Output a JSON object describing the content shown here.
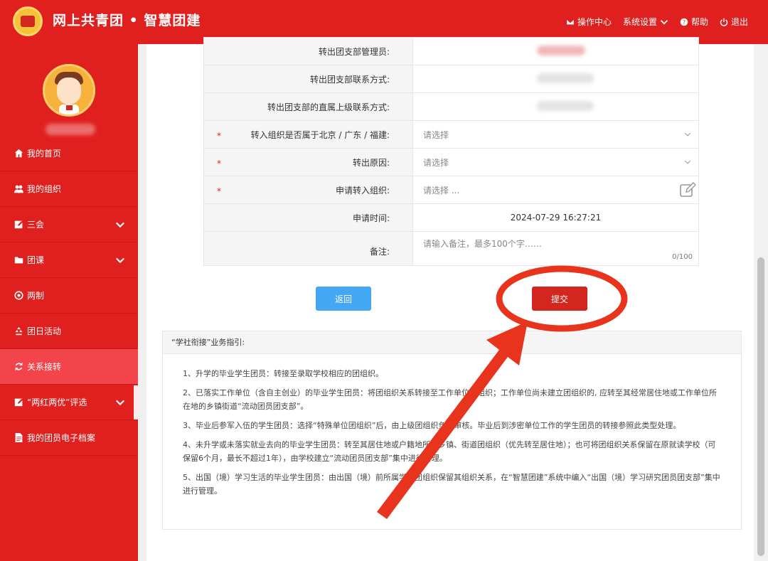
{
  "header": {
    "brand": "网上共青团 • 智慧团建",
    "nav": [
      {
        "icon": "envelope-icon",
        "label": "操作中心"
      },
      {
        "icon": "chevron-down-icon",
        "label": "系统设置"
      },
      {
        "icon": "help-icon",
        "label": "帮助"
      },
      {
        "icon": "power-icon",
        "label": "退出"
      }
    ]
  },
  "sidebar": {
    "items": [
      {
        "label": "我的首页",
        "icon": "home-icon"
      },
      {
        "label": "我的组织",
        "icon": "users-icon"
      },
      {
        "label": "三会",
        "icon": "edit-icon",
        "expandable": true
      },
      {
        "label": "团课",
        "icon": "folder-icon",
        "expandable": true
      },
      {
        "label": "两制",
        "icon": "target-icon"
      },
      {
        "label": "团日活动",
        "icon": "recycle-icon"
      },
      {
        "label": "关系接转",
        "icon": "refresh-icon",
        "active": true
      },
      {
        "label": "“两红两优”评选",
        "icon": "edit-icon",
        "expandable": true
      },
      {
        "label": "我的团员电子档案",
        "icon": "document-icon"
      }
    ]
  },
  "form": {
    "rows": [
      {
        "label": "转出团支部管理员:"
      },
      {
        "label": "转出团支部联系方式:"
      },
      {
        "label": "转出团支部的直属上级联系方式:"
      },
      {
        "label": "转入组织是否属于北京 / 广东 / 福建:",
        "value": "请选择"
      },
      {
        "label": "转出原因:",
        "value": "请选择"
      },
      {
        "label": "申请转入组织:",
        "value": "请选择 ..."
      },
      {
        "label": "申请时间:",
        "value": "2024-07-29 16:27:21"
      },
      {
        "label": "备注:",
        "placeholder": "请输入备注，最多100个字……",
        "counter": "0/100"
      }
    ],
    "required_mark": "*"
  },
  "buttons": {
    "back": "返回",
    "submit": "提交"
  },
  "guide": {
    "title": "“学社衔接”业务指引:",
    "items": [
      "1、升学的毕业学生团员：转接至录取学校相应的团组织。",
      "2、已落实工作单位（含自主创业）的毕业学生团员：将团组织关系转接至工作单位团组织；工作单位尚未建立团组织的, 应转至其经常居住地或工作单位所在地的乡镇街道“流动团员团支部”。",
      "3、毕业后参军入伍的学生团员：选择“特殊单位团组织”后，由上级团组织负责审核。毕业后到涉密单位工作的学生团员的转接参照此类型处理。",
      "4、未升学或未落实就业去向的毕业学生团员：转至其居住地或户籍地所在乡镇、街道团组织（优先转至居住地）；也可将团组织关系保留在原就读学校（可保留6个月，最长不超过1年），由学校建立“流动团员团支部”集中进行管理。",
      "5、出国（境）学习生活的毕业学生团员：由出国（境）前所属学校团组织保留其组织关系，在“智慧团建”系统中编入“出国（境）学习研究团员团支部”集中进行管理。"
    ]
  },
  "colors": {
    "primary": "#e0201f",
    "active": "#f2444a",
    "back": "#43a7f4",
    "submit": "#d3261f"
  }
}
